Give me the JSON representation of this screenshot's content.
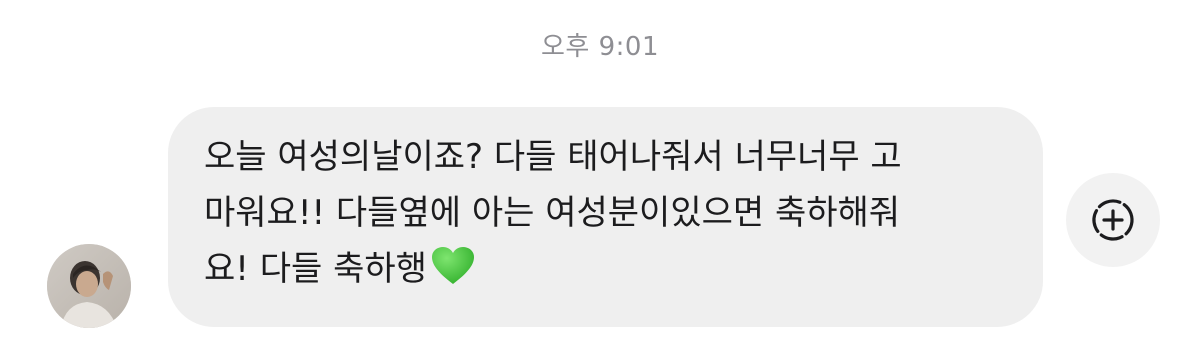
{
  "chat": {
    "timestamp": "오후 9:01",
    "message": {
      "text": "오늘 여성의날이죠? 다들 태어나줘서 너무너무 고\n마워요!! 다들옆에 아는 여성분이있으면 축하해줘\n요! 다들 축하행",
      "emoji": "green-heart-icon"
    },
    "avatar": {
      "icon": "profile-photo"
    },
    "reaction_button": {
      "icon": "add-reaction-icon"
    }
  },
  "colors": {
    "bubble_background": "#efefef",
    "timestamp_text": "#8e8e93",
    "message_text": "#1c1c1e",
    "heart": "#3fc437"
  }
}
